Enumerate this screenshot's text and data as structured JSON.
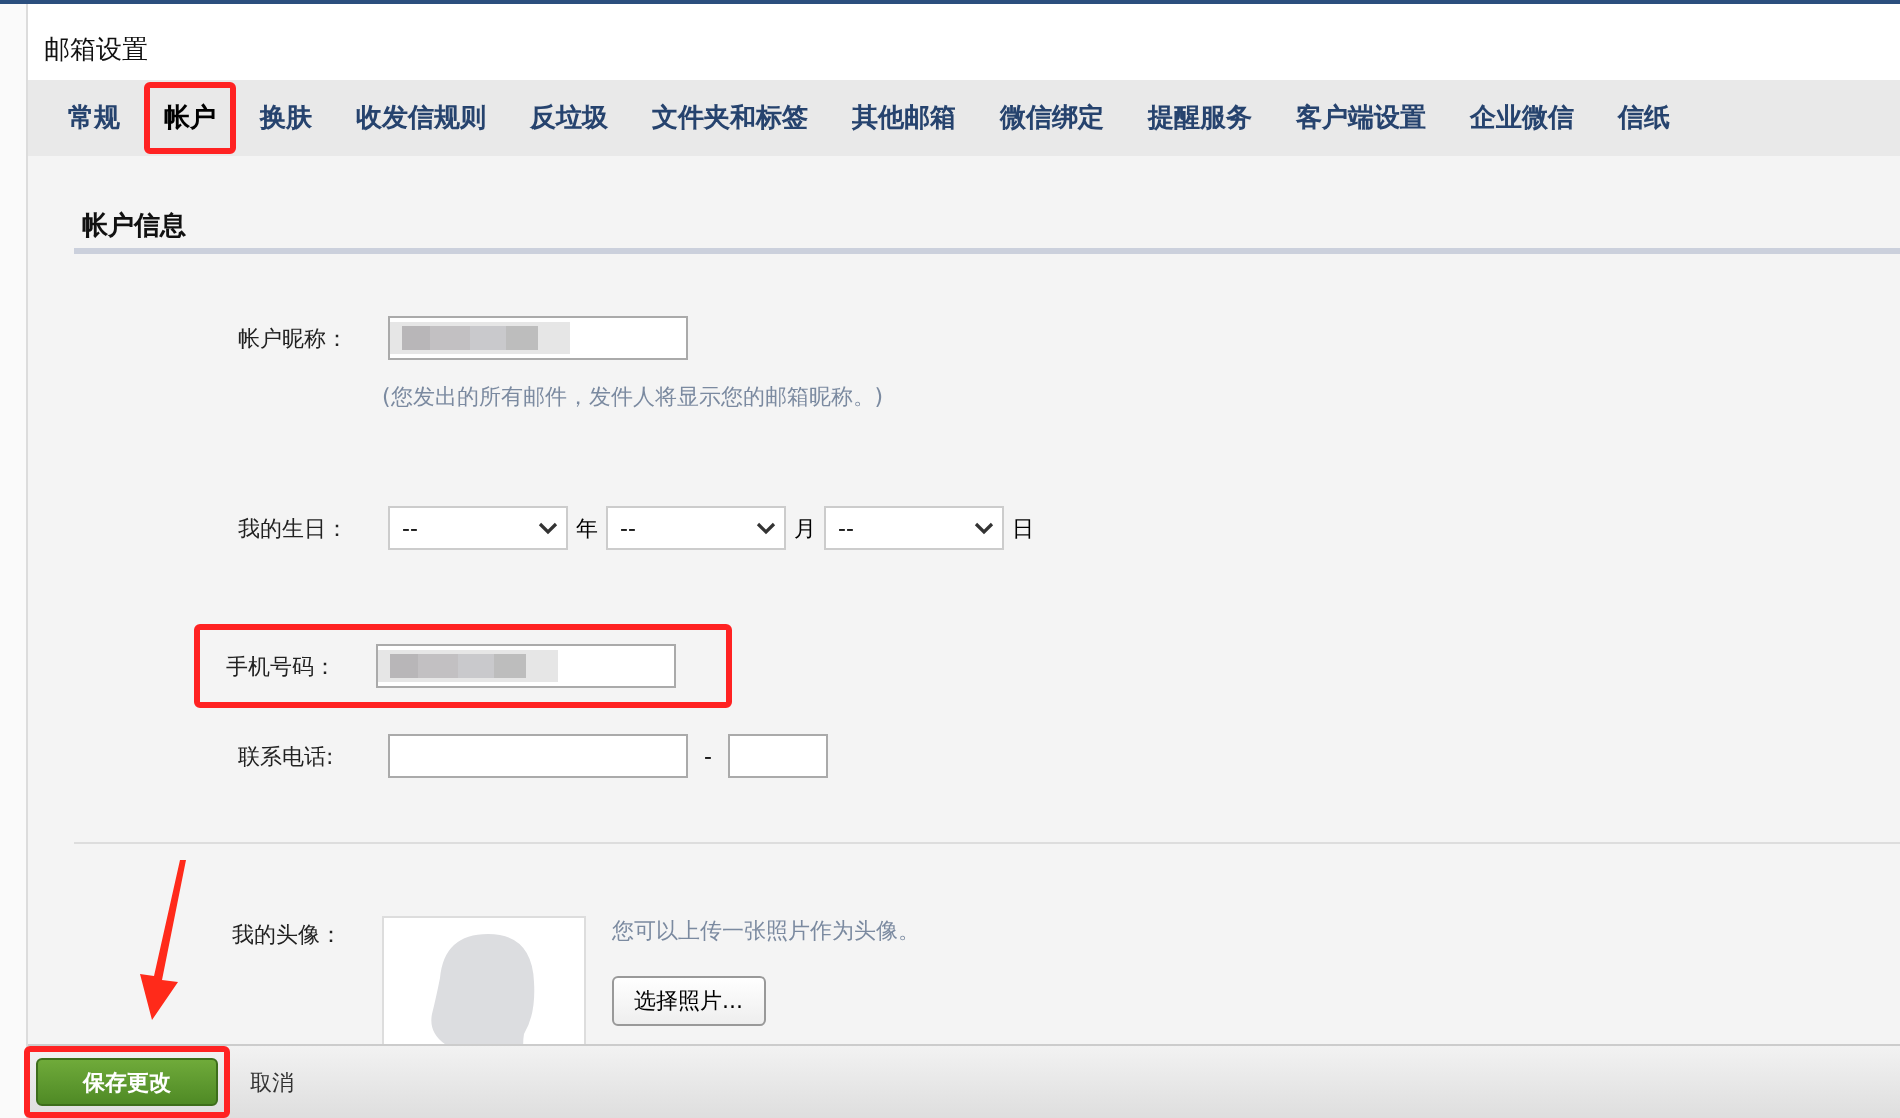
{
  "window": {
    "title": "邮箱设置"
  },
  "tabs": [
    {
      "label": "常规",
      "selected": false,
      "highlighted": false
    },
    {
      "label": "帐户",
      "selected": true,
      "highlighted": true
    },
    {
      "label": "换肤",
      "selected": false,
      "highlighted": false
    },
    {
      "label": "收发信规则",
      "selected": false,
      "highlighted": false
    },
    {
      "label": "反垃圾",
      "selected": false,
      "highlighted": false
    },
    {
      "label": "文件夹和标签",
      "selected": false,
      "highlighted": false
    },
    {
      "label": "其他邮箱",
      "selected": false,
      "highlighted": false
    },
    {
      "label": "微信绑定",
      "selected": false,
      "highlighted": false
    },
    {
      "label": "提醒服务",
      "selected": false,
      "highlighted": false
    },
    {
      "label": "客户端设置",
      "selected": false,
      "highlighted": false
    },
    {
      "label": "企业微信",
      "selected": false,
      "highlighted": false
    },
    {
      "label": "信纸",
      "selected": false,
      "highlighted": false
    }
  ],
  "section": {
    "title": "帐户信息"
  },
  "fields": [
    {
      "kind": "text",
      "label": "帐户昵称：",
      "redacted": true,
      "highlighted": false,
      "hint": "(您发出的所有邮件，发件人将显示您的邮箱昵称。)"
    },
    {
      "kind": "date",
      "label": "我的生日：",
      "highlighted": false,
      "selects": [
        {
          "value": "--",
          "unit": "年"
        },
        {
          "value": "--",
          "unit": "月"
        },
        {
          "value": "--",
          "unit": "日"
        }
      ]
    },
    {
      "kind": "text",
      "label": "手机号码：",
      "redacted": true,
      "highlighted": true
    },
    {
      "kind": "phone",
      "label": "联系电话:",
      "highlighted": false,
      "separator": "-"
    }
  ],
  "avatar": {
    "label": "我的头像：",
    "note": "您可以上传一张照片作为头像。",
    "button": "选择照片..."
  },
  "footer": {
    "save": {
      "label": "保存更改",
      "highlighted": true
    },
    "cancel": "取消"
  },
  "pointer_arrow": true
}
